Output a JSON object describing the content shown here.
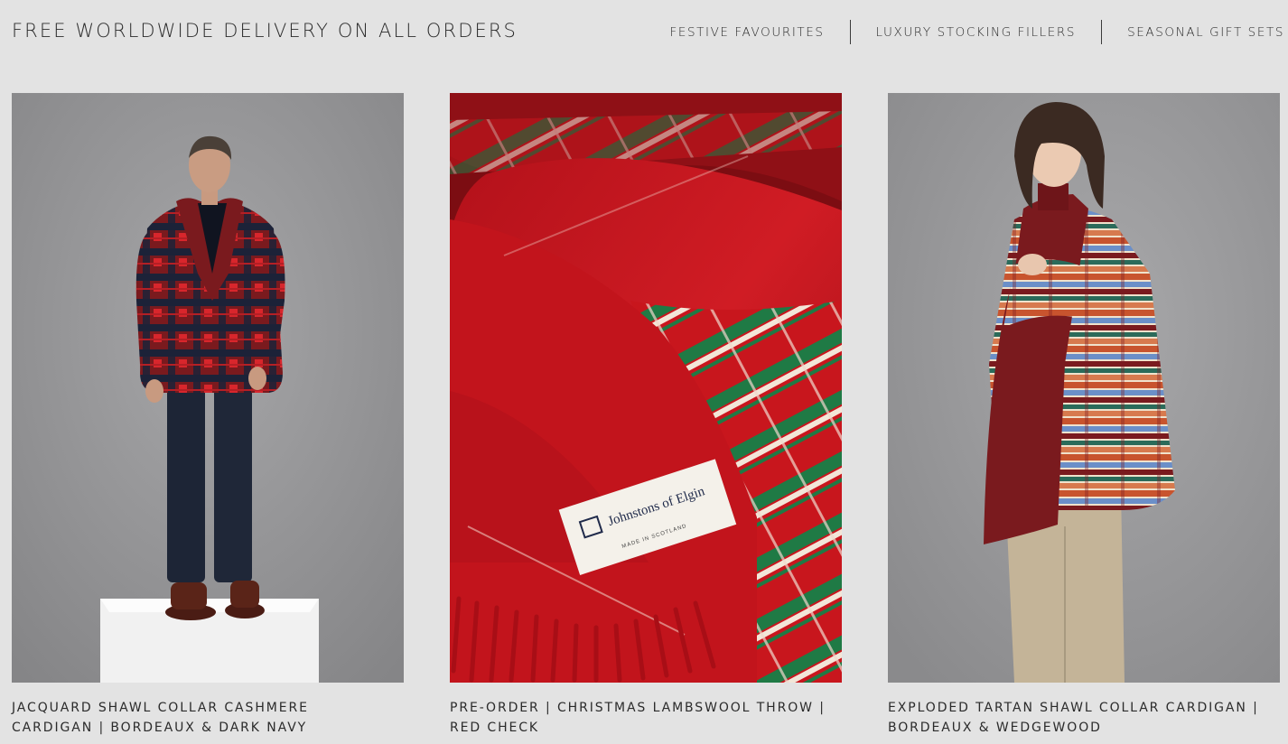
{
  "header": {
    "banner": "FREE WORLDWIDE DELIVERY ON ALL ORDERS",
    "nav": [
      {
        "label": "FESTIVE FAVOURITES"
      },
      {
        "label": "LUXURY STOCKING FILLERS"
      },
      {
        "label": "SEASONAL GIFT SETS"
      }
    ]
  },
  "products": [
    {
      "title": "JACQUARD SHAWL COLLAR CASHMERE CARDIGAN | BORDEAUX & DARK NAVY",
      "image_alt": "Man in bordeaux and navy jacquard shawl collar cardigan standing on white plinth"
    },
    {
      "title": "PRE-ORDER | CHRISTMAS LAMBSWOOL THROW | RED CHECK",
      "image_alt": "Close-up of red check lambswool throw with fringe and label",
      "label_brand": "Johnstons of Elgin",
      "label_made": "MADE IN SCOTLAND"
    },
    {
      "title": "EXPLODED TARTAN SHAWL COLLAR CARDIGAN | BORDEAUX & WEDGEWOOD",
      "image_alt": "Woman in multicolour striped tartan shawl collar cardigan"
    }
  ],
  "colors": {
    "background": "#e3e3e3",
    "text": "#2b2b2b",
    "bordeaux": "#7a1a1e",
    "throw_red": "#c8161d",
    "throw_green": "#1f7a45",
    "studio_grey": "#9a9a9c"
  }
}
